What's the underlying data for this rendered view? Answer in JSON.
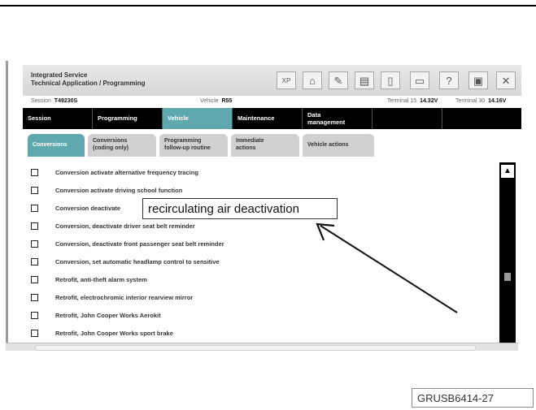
{
  "window": {
    "title_line1": "Integrated Service",
    "title_line2": "Technical Application / Programming"
  },
  "toolbar": {
    "icons": [
      "xml-icon",
      "home-icon",
      "wrench-icon",
      "notes-icon",
      "clipboard-icon",
      "printer-icon",
      "help-icon",
      "minimize-icon",
      "close-icon"
    ],
    "glyphs": [
      "XP",
      "⌂",
      "✎",
      "▤",
      "▯",
      "▭",
      "?",
      "▣",
      "✕"
    ]
  },
  "infobar": {
    "session_label": "Session",
    "session_value": "T49230S",
    "vehicle_label": "Vehicle",
    "vehicle_value": "R55",
    "terminal15_label": "Terminal 15",
    "terminal15_value": "14.32V",
    "terminal30_label": "Terminal 30",
    "terminal30_value": "14.16V"
  },
  "nav": {
    "items": [
      {
        "label": "Session"
      },
      {
        "label": "Programming"
      },
      {
        "label": "Vehicle"
      },
      {
        "label": "Maintenance"
      },
      {
        "label_line1": "Data",
        "label_line2": "management"
      }
    ]
  },
  "subtabs": {
    "items": [
      {
        "label": "Conversions"
      },
      {
        "label_line1": "Conversions",
        "label_line2": "(coding only)"
      },
      {
        "label_line1": "Programming",
        "label_line2": "follow-up routine"
      },
      {
        "label_line1": "Immediate",
        "label_line2": "actions"
      },
      {
        "label": "Vehicle actions"
      }
    ]
  },
  "list": {
    "items": [
      "Conversion activate alternative frequency tracing",
      "Conversion activate driving school function",
      "Conversion deactivate",
      "Conversion, deactivate driver seat belt reminder",
      "Conversion, deactivate front passenger seat belt reminder",
      "Conversion, set automatic headlamp control to sensitive",
      "Retrofit, anti-theft alarm system",
      "Retrofit, electrochromic interior rearview mirror",
      "Retrofit, John Cooper Works Aerokit",
      "Retrofit, John Cooper Works sport brake"
    ]
  },
  "callout": {
    "text": "recirculating air deactivation"
  },
  "image_id": "GRUSB6414-27",
  "colors": {
    "active_tab": "#5fa8ad",
    "nav_bar": "#000000"
  }
}
